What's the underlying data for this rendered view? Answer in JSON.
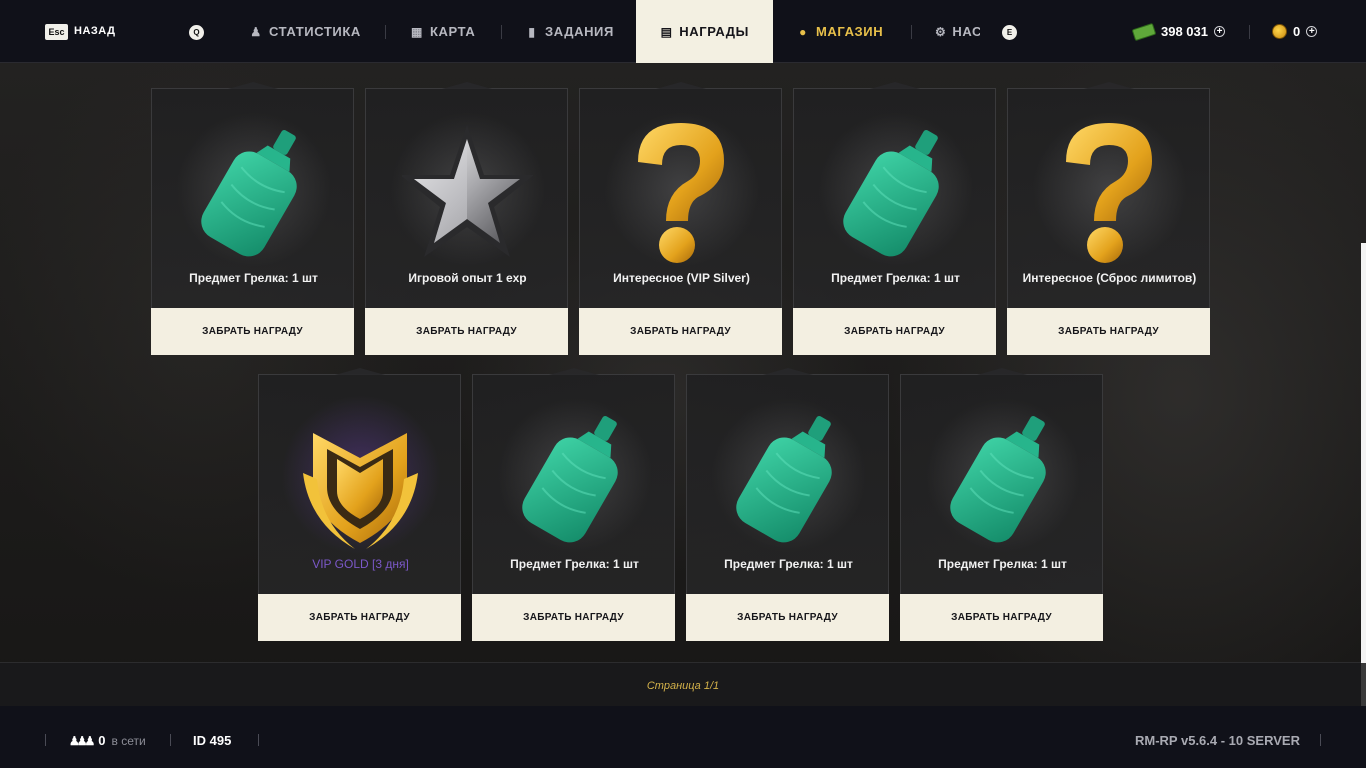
{
  "header": {
    "esc_key": "Esc",
    "back_label": "НАЗАД",
    "key_left": "Q",
    "key_right": "E",
    "tabs": [
      {
        "label": "СТАТИСТИКА",
        "icon": "person-icon"
      },
      {
        "label": "КАРТА",
        "icon": "map-icon"
      },
      {
        "label": "ЗАДАНИЯ",
        "icon": "tasks-icon"
      },
      {
        "label": "НАГРАДЫ",
        "icon": "gift-icon",
        "active": true
      },
      {
        "label": "МАГАЗИН",
        "icon": "coins-icon",
        "color": "#e8c04a"
      },
      {
        "label": "НАСТРОЙКИ",
        "icon": "gear-icon"
      }
    ],
    "money": "398 031",
    "coins": "0"
  },
  "rewards": [
    {
      "title": "Предмет Грелка: 1 шт",
      "image": "hot-water-bottle-icon",
      "button": "ЗАБРАТЬ НАГРАДУ"
    },
    {
      "title": "Игровой опыт 1 exp",
      "image": "silver-star-icon",
      "button": "ЗАБРАТЬ НАГРАДУ"
    },
    {
      "title": "Интересное (VIP Silver)",
      "image": "question-mark-icon",
      "button": "ЗАБРАТЬ НАГРАДУ"
    },
    {
      "title": "Предмет Грелка: 1 шт",
      "image": "hot-water-bottle-icon",
      "button": "ЗАБРАТЬ НАГРАДУ"
    },
    {
      "title": "Интересное (Сброс лимитов)",
      "image": "question-mark-icon",
      "button": "ЗАБРАТЬ НАГРАДУ"
    },
    {
      "title": "VIP GOLD [3 дня]",
      "image": "gold-vip-badge-icon",
      "button": "ЗАБРАТЬ НАГРАДУ",
      "title_color": "#7b58c8"
    },
    {
      "title": "Предмет Грелка: 1 шт",
      "image": "hot-water-bottle-icon",
      "button": "ЗАБРАТЬ НАГРАДУ"
    },
    {
      "title": "Предмет Грелка: 1 шт",
      "image": "hot-water-bottle-icon",
      "button": "ЗАБРАТЬ НАГРАДУ"
    },
    {
      "title": "Предмет Грелка: 1 шт",
      "image": "hot-water-bottle-icon",
      "button": "ЗАБРАТЬ НАГРАДУ"
    }
  ],
  "pager": {
    "label": "Страница 1/1"
  },
  "footer": {
    "online_count": "0",
    "online_label": "в сети",
    "player_id": "ID 495",
    "server": "RM-RP v5.6.4 - 10 SERVER"
  },
  "colors": {
    "accent_gold": "#e8c04a",
    "active_tab_bg": "#f3f0e2",
    "button_bg": "#f3efe1",
    "bottle_green": "#2bb08a",
    "vip_purple": "#7b58c8"
  }
}
